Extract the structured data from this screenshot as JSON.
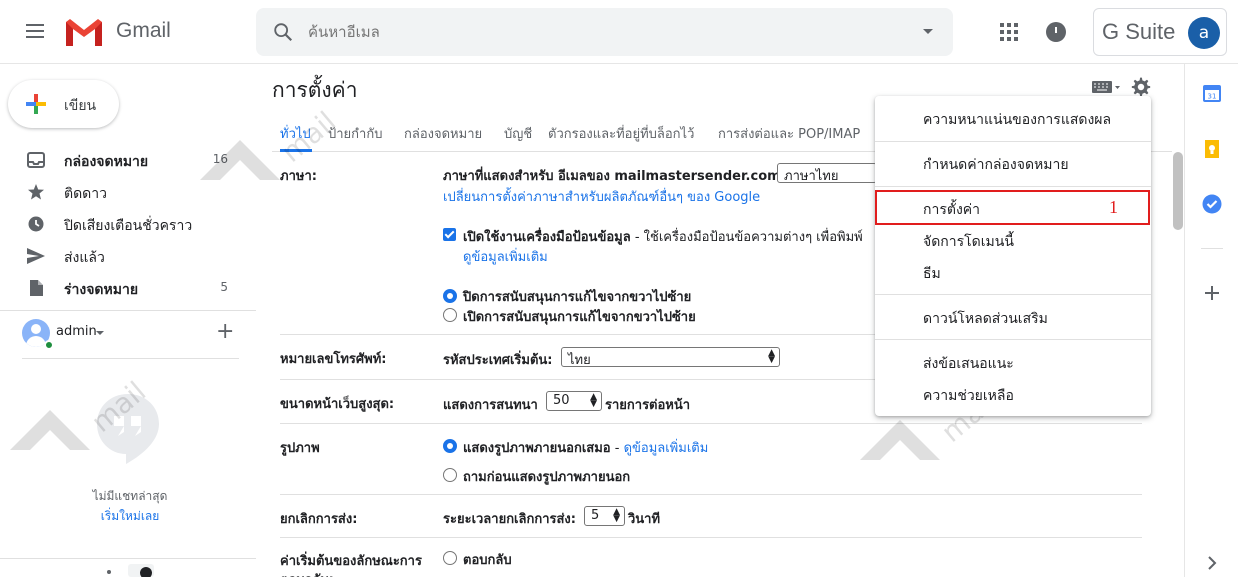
{
  "header": {
    "app_name": "Gmail",
    "search_placeholder": "ค้นหาอีเมล",
    "gsuite_label": "G Suite",
    "avatar_letter": "a"
  },
  "sidebar": {
    "compose_label": "เขียน",
    "items": [
      {
        "label": "กล่องจดหมาย",
        "count": "16",
        "icon": "inbox-icon"
      },
      {
        "label": "ติดดาว",
        "count": "",
        "icon": "star-icon"
      },
      {
        "label": "ปิดเสียงเตือนชั่วคราว",
        "count": "",
        "icon": "snooze-clock-icon"
      },
      {
        "label": "ส่งแล้ว",
        "count": "",
        "icon": "send-icon"
      },
      {
        "label": "ร่างจดหมาย",
        "count": "5",
        "icon": "draft-icon"
      }
    ],
    "account_name": "admin",
    "no_chat_text": "ไม่มีแชทล่าสุด",
    "start_chat_link": "เริ่มใหม่เลย"
  },
  "main": {
    "title": "การตั้งค่า",
    "tabs": [
      "ทั่วไป",
      "ป้ายกำกับ",
      "กล่องจดหมาย",
      "บัญชี",
      "ตัวกรองและที่อยู่ที่บล็อกไว้",
      "การส่งต่อและ POP/IMAP"
    ],
    "language": {
      "label": "ภาษา:",
      "display_text": "ภาษาที่แสดงสำหรับ อีเมลของ mailmastersender.com:",
      "value": "ภาษาไทย",
      "change_link": "เปลี่ยนการตั้งค่าภาษาสำหรับผลิตภัณฑ์อื่นๆ ของ Google",
      "input_tools_label": "เปิดใช้งานเครื่องมือป้อนข้อมูล",
      "input_tools_desc": " - ใช้เครื่องมือป้อนข้อความต่างๆ เพื่อพิมพ์",
      "more_info": "ดูข้อมูลเพิ่มเติม",
      "rtl_off": "ปิดการสนับสนุนการแก้ไขจากขวาไปซ้าย",
      "rtl_on": "เปิดการสนับสนุนการแก้ไขจากขวาไปซ้าย"
    },
    "phone": {
      "label": "หมายเลขโทรศัพท์:",
      "country_label": "รหัสประเทศเริ่มต้น:",
      "value": "ไทย"
    },
    "page_size": {
      "label": "ขนาดหน้าเว็บสูงสุด:",
      "prefix": "แสดงการสนทนา",
      "value": "50",
      "suffix": "รายการต่อหน้า"
    },
    "images": {
      "label": "รูปภาพ",
      "always": "แสดงรูปภาพภายนอกเสมอ",
      "sep": " - ",
      "more_info": "ดูข้อมูลเพิ่มเติม",
      "ask": "ถามก่อนแสดงรูปภาพภายนอก"
    },
    "undo_send": {
      "label": "ยกเลิกการส่ง:",
      "prefix": "ระยะเวลายกเลิกการส่ง:",
      "value": "5",
      "suffix": "วินาที"
    },
    "reply_default": {
      "label_line1": "ค่าเริ่มต้นของลักษณะการ",
      "label_line2": "ตอบกลับ:",
      "option": "ตอบกลับ"
    }
  },
  "dropdown": {
    "items": [
      "ความหนาแน่นของการแสดงผล",
      "กำหนดค่ากล่องจดหมาย",
      "การตั้งค่า",
      "จัดการโดเมนนี้",
      "ธีม",
      "ดาวน์โหลดส่วนเสริม",
      "ส่งข้อเสนอแนะ",
      "ความช่วยเหลือ"
    ],
    "highlight_number": "1"
  },
  "colors": {
    "accent": "#1a73e8",
    "highlight": "#e11d1d",
    "avatar_bg": "#1a5fa8"
  }
}
